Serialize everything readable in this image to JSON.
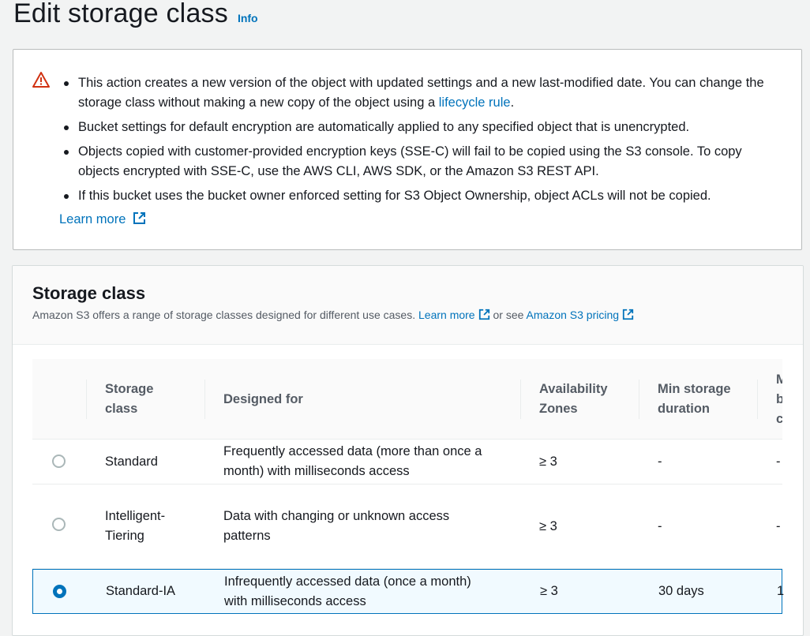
{
  "header": {
    "title": "Edit storage class",
    "info": "Info"
  },
  "alert": {
    "bullets": [
      {
        "text": "This action creates a new version of the object with updated settings and a new last-modified date. You can change the storage class without making a new copy of the object using a ",
        "link": "lifecycle rule",
        "after": "."
      },
      {
        "text": "Bucket settings for default encryption are automatically applied to any specified object that is unencrypted."
      },
      {
        "text": "Objects copied with customer-provided encryption keys (SSE-C) will fail to be copied using the S3 console. To copy objects encrypted with SSE-C, use the AWS CLI, AWS SDK, or the Amazon S3 REST API."
      },
      {
        "text": "If this bucket uses the bucket owner enforced setting for S3 Object Ownership, object ACLs will not be copied."
      }
    ],
    "learn_more": "Learn more",
    "warning_color": "#d13212"
  },
  "storage_class": {
    "title": "Storage class",
    "description": "Amazon S3 offers a range of storage classes designed for different use cases.",
    "learn_more": "Learn more",
    "or_see": "or see",
    "pricing_link": "Amazon S3 pricing",
    "columns": [
      "Storage class",
      "Designed for",
      "Availability Zones",
      "Min storage duration",
      "M b c"
    ],
    "rows": [
      {
        "name": "Standard",
        "designed_for": "Frequently accessed data (more than once a month) with milliseconds access",
        "az": "≥ 3",
        "min_duration": "-",
        "next": "-",
        "selected": false
      },
      {
        "name": "Intelligent-Tiering",
        "designed_for": "Data with changing or unknown access patterns",
        "az": "≥ 3",
        "min_duration": "-",
        "next": "-",
        "selected": false
      },
      {
        "name": "Standard-IA",
        "designed_for": "Infrequently accessed data (once a month) with milliseconds access",
        "az": "≥ 3",
        "min_duration": "30 days",
        "next": "1",
        "selected": true
      }
    ]
  },
  "colors": {
    "accent": "#0073bb",
    "background": "#f2f3f3"
  }
}
